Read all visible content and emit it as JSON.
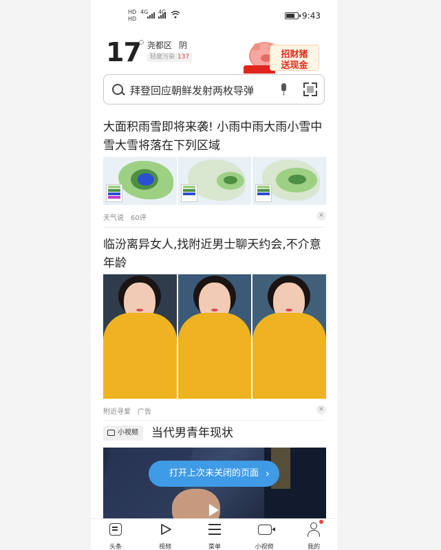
{
  "status_bar": {
    "sim1": "HD",
    "sim2": "HD",
    "net1": "4G",
    "net2": "4G",
    "time": "9:43"
  },
  "weather": {
    "temperature": "17",
    "district": "尧都区",
    "condition": "阴",
    "air_quality_label": "轻度污染",
    "air_quality_value": "137"
  },
  "promo": {
    "line1": "招财猪",
    "line2": "送现金"
  },
  "search": {
    "query": "拜登回应朝鲜发射两枚导弹"
  },
  "feed": [
    {
      "title": "大面积雨雪即将来袭! 小雨中雨大雨小雪中雪大雪将落在下列区域",
      "source": "天气说",
      "comments": "60评"
    },
    {
      "title": "临汾离异女人,找附近男士聊天约会,不介意年龄",
      "source": "附近寻爱",
      "tag": "广告"
    }
  ],
  "video_section": {
    "badge": "小视频",
    "title": "当代男青年现状"
  },
  "toast": {
    "text": "打开上次未关闭的页面",
    "arrow": "›"
  },
  "dismiss_icon": "✕",
  "tabbar": [
    {
      "label": "头条",
      "icon": "home-icon"
    },
    {
      "label": "视频",
      "icon": "play-icon"
    },
    {
      "label": "菜单",
      "icon": "menu-icon"
    },
    {
      "label": "小视频",
      "icon": "video-camera-icon"
    },
    {
      "label": "我的",
      "icon": "user-icon"
    }
  ],
  "colors": {
    "accent_red": "#e02a1e",
    "toast_blue": "#3f9be6",
    "aq_red": "#e23c3c"
  }
}
